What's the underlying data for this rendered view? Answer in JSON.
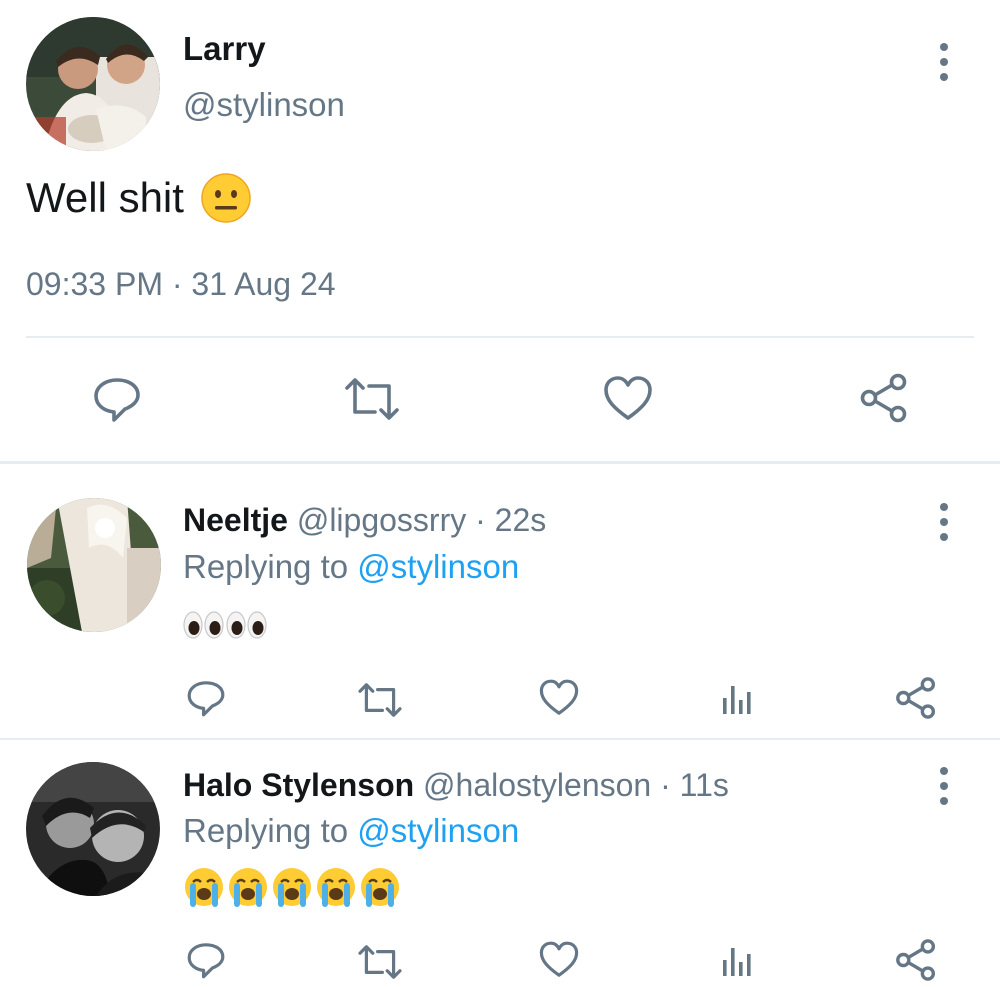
{
  "main_tweet": {
    "author_name": "Larry",
    "handle": "@stylinson",
    "text": "Well shit",
    "timestamp": "09:33 PM · 31 Aug 24",
    "emoji": "neutral-face",
    "actions": [
      "reply-icon",
      "retweet-icon",
      "like-icon",
      "share-icon"
    ]
  },
  "replies": [
    {
      "author_name": "Neeltje",
      "handle": "@lipgossrry",
      "time": "· 22s",
      "replying_prefix": "Replying to",
      "replying_handle": "@stylinson",
      "emoji": [
        "eyes",
        "eyes"
      ],
      "actions": [
        "reply-icon",
        "retweet-icon",
        "like-icon",
        "analytics-icon",
        "share-icon"
      ]
    },
    {
      "author_name": "Halo Stylenson",
      "handle": "@halostylenson",
      "time": "· 11s",
      "replying_prefix": "Replying to",
      "replying_handle": "@stylinson",
      "emoji": [
        "loudly-crying-face",
        "loudly-crying-face",
        "loudly-crying-face",
        "loudly-crying-face",
        "loudly-crying-face"
      ],
      "actions": [
        "reply-icon",
        "retweet-icon",
        "like-icon",
        "analytics-icon",
        "share-icon"
      ]
    }
  ],
  "colors": {
    "text": "#14171a",
    "muted": "#657786",
    "link": "#1da1f2",
    "divider": "#e6ecf0"
  }
}
